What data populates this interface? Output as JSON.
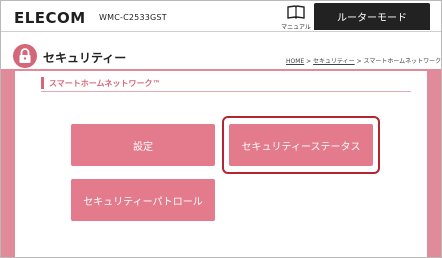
{
  "header": {
    "brand": "ELECOM",
    "model": "WMC-C2533GST",
    "manual_label": "マニュアル",
    "mode_tab": "ルーターモード"
  },
  "page": {
    "title": "セキュリティー",
    "breadcrumb": {
      "home": "HOME",
      "sep1": " > ",
      "security": "セキュリティー",
      "sep2": " > ",
      "current": "スマートホームネットワーク"
    }
  },
  "section": {
    "title": "スマートホームネットワーク™"
  },
  "buttons": {
    "settings": "設定",
    "status": "セキュリティーステータス",
    "patrol": "セキュリティーパトロール"
  },
  "colors": {
    "accent": "#d5677a",
    "button": "#e37b8c",
    "panel": "#e08a9a",
    "focus_ring": "#b3262f",
    "mode_tab": "#222222"
  }
}
